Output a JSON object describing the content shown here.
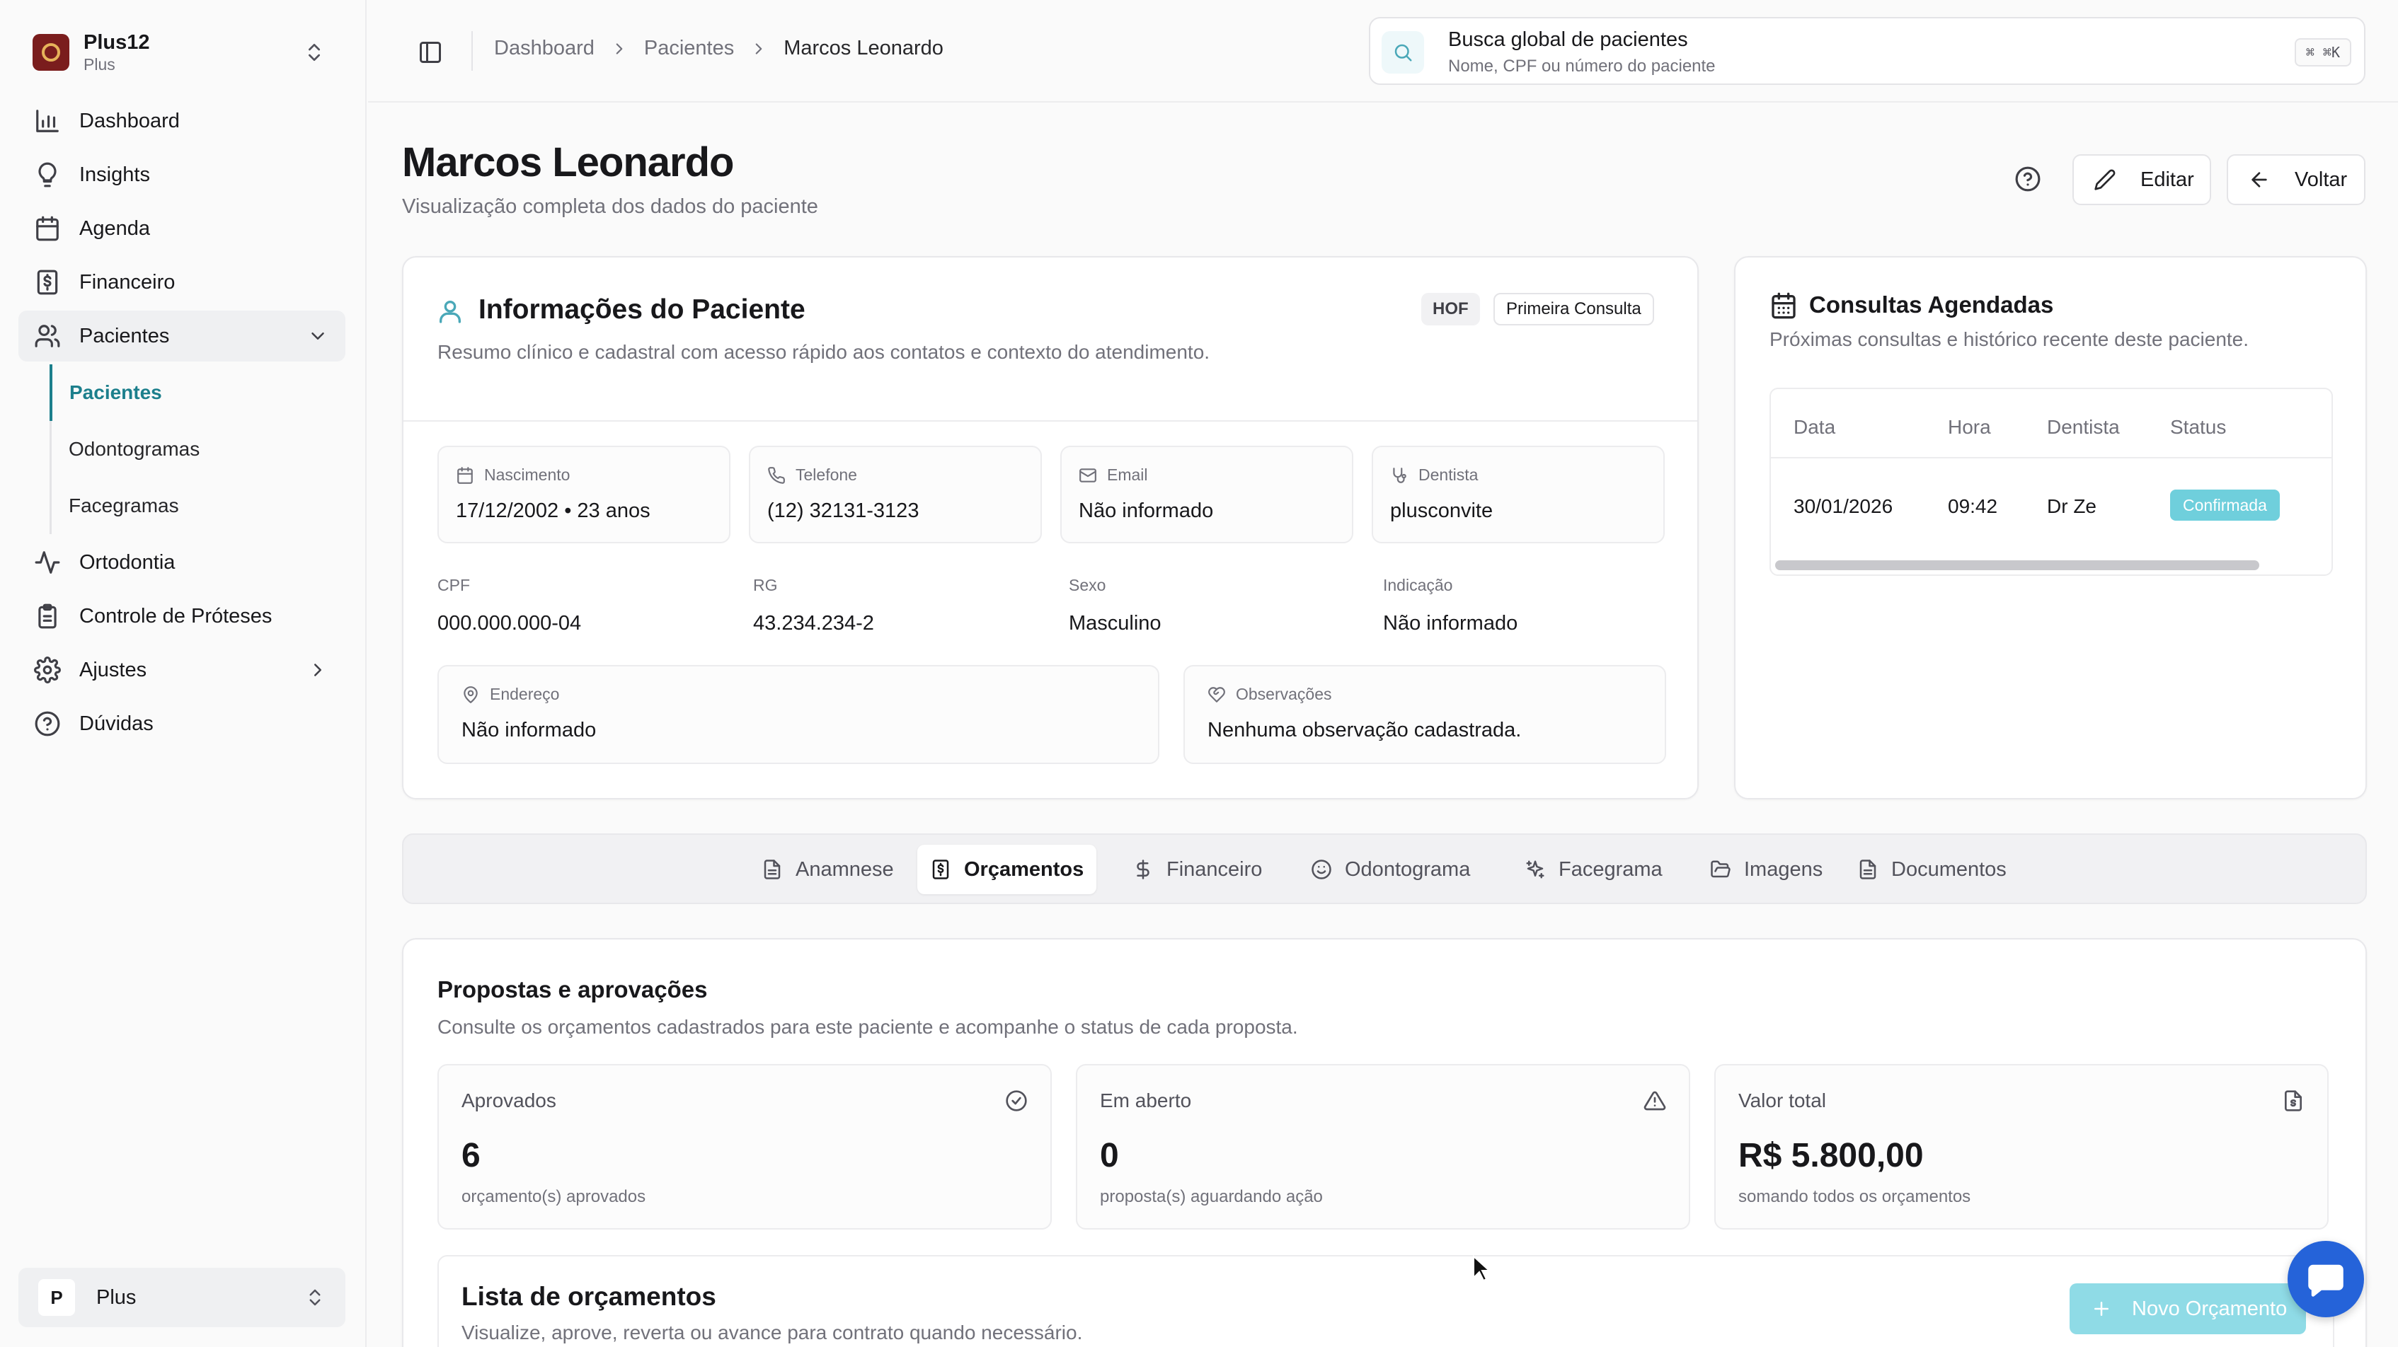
{
  "brand": {
    "name": "Plus12",
    "plan": "Plus"
  },
  "sidebar": {
    "items": [
      {
        "label": "Dashboard",
        "icon": "bar-chart-icon"
      },
      {
        "label": "Insights",
        "icon": "lightbulb-icon"
      },
      {
        "label": "Agenda",
        "icon": "calendar-icon"
      },
      {
        "label": "Financeiro",
        "icon": "dollar-receipt-icon"
      },
      {
        "label": "Pacientes",
        "icon": "users-icon"
      },
      {
        "label": "Ortodontia",
        "icon": "activity-icon"
      },
      {
        "label": "Controle de Próteses",
        "icon": "clipboard-icon"
      },
      {
        "label": "Ajustes",
        "icon": "gear-icon"
      },
      {
        "label": "Dúvidas",
        "icon": "help-circle-icon"
      }
    ],
    "sub_items": [
      {
        "label": "Pacientes"
      },
      {
        "label": "Odontogramas"
      },
      {
        "label": "Facegramas"
      }
    ]
  },
  "workspace": {
    "initial": "P",
    "name": "Plus"
  },
  "breadcrumb": {
    "items": [
      "Dashboard",
      "Pacientes"
    ],
    "current": "Marcos Leonardo"
  },
  "search": {
    "title": "Busca global de pacientes",
    "placeholder": "Nome, CPF ou número do paciente",
    "shortcut": "⌘ ⌘K"
  },
  "header": {
    "title": "Marcos Leonardo",
    "subtitle": "Visualização completa dos dados do paciente",
    "edit_label": "Editar",
    "back_label": "Voltar"
  },
  "patient_info": {
    "title": "Informações do Paciente",
    "description": "Resumo clínico e cadastral com acesso rápido aos contatos e contexto do atendimento.",
    "badges": [
      "HOF",
      "Primeira Consulta"
    ],
    "nascimento": {
      "label": "Nascimento",
      "value": "17/12/2002 • 23 anos"
    },
    "telefone": {
      "label": "Telefone",
      "value": "(12) 32131-3123"
    },
    "email": {
      "label": "Email",
      "value": "Não informado"
    },
    "dentista": {
      "label": "Dentista",
      "value": "plusconvite"
    },
    "cpf": {
      "label": "CPF",
      "value": "000.000.000-04"
    },
    "rg": {
      "label": "RG",
      "value": "43.234.234-2"
    },
    "sexo": {
      "label": "Sexo",
      "value": "Masculino"
    },
    "indicacao": {
      "label": "Indicação",
      "value": "Não informado"
    },
    "endereco": {
      "label": "Endereço",
      "value": "Não informado"
    },
    "observacoes": {
      "label": "Observações",
      "value": "Nenhuma observação cadastrada."
    }
  },
  "appointments": {
    "title": "Consultas Agendadas",
    "description": "Próximas consultas e histórico recente deste paciente.",
    "columns": [
      "Data",
      "Hora",
      "Dentista",
      "Status"
    ],
    "rows": [
      {
        "data": "30/01/2026",
        "hora": "09:42",
        "dentista": "Dr Ze",
        "status": "Confirmada"
      }
    ],
    "status_color": "#6fcfdc"
  },
  "tabs": [
    {
      "label": "Anamnese"
    },
    {
      "label": "Orçamentos"
    },
    {
      "label": "Financeiro"
    },
    {
      "label": "Odontograma"
    },
    {
      "label": "Facegrama"
    },
    {
      "label": "Imagens"
    },
    {
      "label": "Documentos"
    }
  ],
  "budgets": {
    "title": "Propostas e aprovações",
    "description": "Consulte os orçamentos cadastrados para este paciente e acompanhe o status de cada proposta.",
    "stats": [
      {
        "label": "Aprovados",
        "value": "6",
        "note": "orçamento(s) aprovados",
        "icon": "check-circle-icon"
      },
      {
        "label": "Em aberto",
        "value": "0",
        "note": "proposta(s) aguardando ação",
        "icon": "alert-triangle-icon"
      },
      {
        "label": "Valor total",
        "value": "R$ 5.800,00",
        "note": "somando todos os orçamentos",
        "icon": "file-dollar-icon"
      }
    ],
    "list": {
      "title": "Lista de orçamentos",
      "description": "Visualize, aprove, reverta ou avance para contrato quando necessário.",
      "new_label": "Novo Orçamento"
    }
  },
  "colors": {
    "accent": "#1c7f8c",
    "accent_light": "#8fdbe6",
    "chat": "#2563d9",
    "brand_logo": "#7a1d1d"
  }
}
